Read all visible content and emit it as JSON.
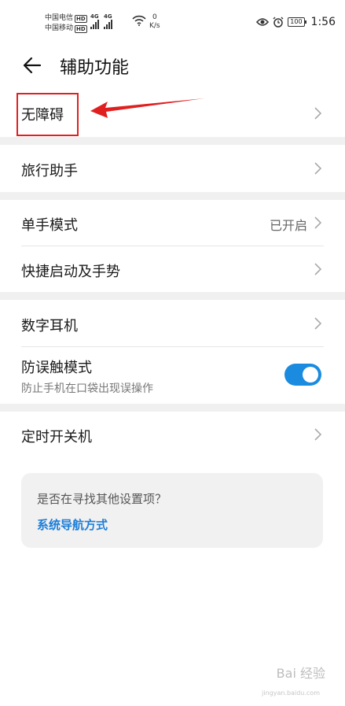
{
  "status_bar": {
    "carrier1": "中国电信",
    "carrier2": "中国移动",
    "hd": "HD",
    "net1": "4G",
    "net2": "4G",
    "speed_value": "0",
    "speed_unit": "K/s",
    "battery": "100",
    "time": "1:56"
  },
  "header": {
    "title": "辅助功能"
  },
  "rows": {
    "accessibility": {
      "label": "无障碍"
    },
    "travel": {
      "label": "旅行助手"
    },
    "one_hand": {
      "label": "单手模式",
      "value": "已开启"
    },
    "shortcuts": {
      "label": "快捷启动及手势"
    },
    "earphone": {
      "label": "数字耳机"
    },
    "mistouch": {
      "label": "防误触模式",
      "subtitle": "防止手机在口袋出现误操作",
      "enabled": true
    },
    "schedule": {
      "label": "定时开关机"
    }
  },
  "suggestion": {
    "question": "是否在寻找其他设置项？",
    "link": "系统导航方式"
  },
  "watermark": {
    "brand": "Bai 经验",
    "url": "jingyan.baidu.com"
  },
  "colors": {
    "accent": "#1b8be0",
    "annotation": "#e02020",
    "link": "#1d7ed8"
  }
}
